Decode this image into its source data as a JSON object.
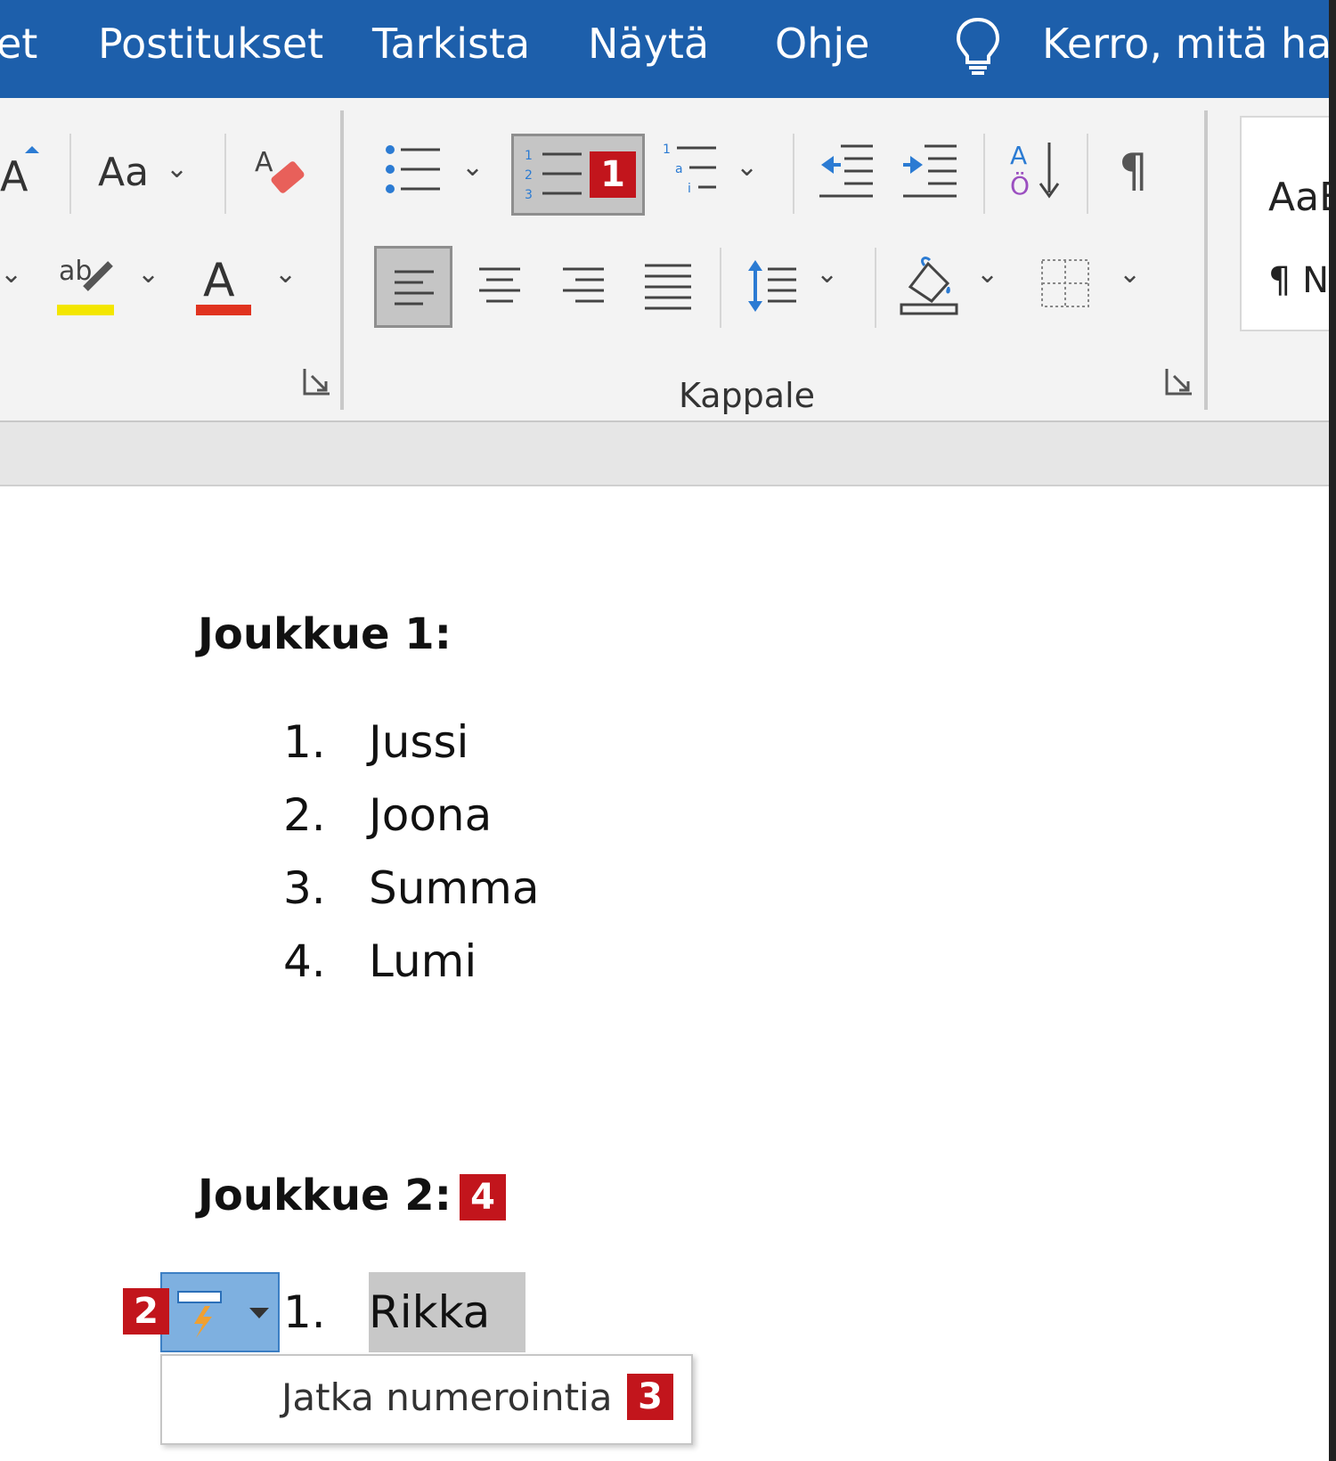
{
  "tabs": [
    "et",
    "Postitukset",
    "Tarkista",
    "Näytä",
    "Ohje"
  ],
  "tell_me": "Kerro, mitä halu",
  "ribbon": {
    "change_case_label": "Aa",
    "group_label": "Kappale",
    "styles_preview": "AaB",
    "styles_normal": "¶ N"
  },
  "document": {
    "heading1": "Joukkue 1:",
    "list1": [
      {
        "num": "1.",
        "text": "Jussi"
      },
      {
        "num": "2.",
        "text": "Joona"
      },
      {
        "num": "3.",
        "text": "Summa"
      },
      {
        "num": "4.",
        "text": "Lumi"
      }
    ],
    "heading2": "Joukkue 2:",
    "list2_item": {
      "num": "1.",
      "text": "Rikka"
    }
  },
  "popup": {
    "item": "Jatka numerointia"
  },
  "badges": [
    "1",
    "2",
    "3",
    "4"
  ],
  "colors": {
    "tabbar": "#1d5fab",
    "highlight_yellow": "#f3e600",
    "font_red": "#e0331f",
    "badge_red": "#c2151c",
    "autocorrect_blue": "#7eb0e0"
  }
}
